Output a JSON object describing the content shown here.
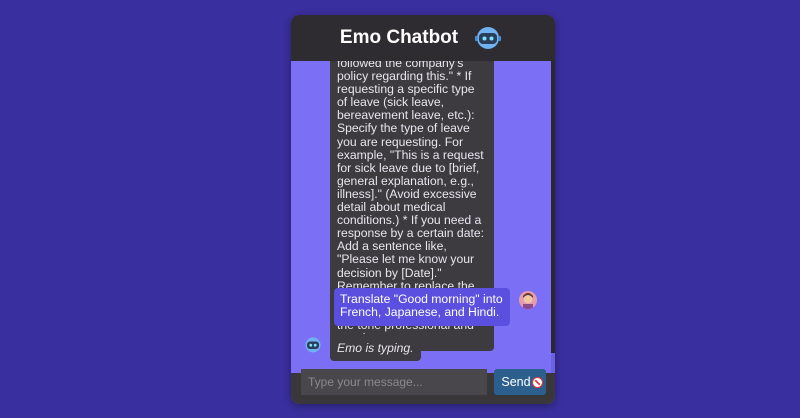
{
  "header": {
    "title": "Emo Chatbot",
    "icon": "robot-icon"
  },
  "messages": {
    "bot_response": "followed the company's policy regarding this.\" * If requesting a specific type of leave (sick leave, bereavement leave, etc.): Specify the type of leave you are requesting. For example, \"This is a request for sick leave due to [brief, general explanation, e.g., illness].\" (Avoid excessive detail about medical conditions.) * If you need a response by a certain date: Add a sentence like, \"Please let me know your decision by [Date].\" Remember to replace the bracketed information with your specific details. Keep the tone professional and concise.",
    "user_message": "Translate \"Good morning\" into French, Japanese, and Hindi.",
    "typing_text": "Emo is typing."
  },
  "input": {
    "placeholder": "Type your message...",
    "send_label": "Send"
  },
  "colors": {
    "page_background": "#3a2f9e",
    "chat_background": "#7b70f5",
    "header_background": "#2f2c31",
    "bot_bubble": "#3d3a40",
    "user_bubble": "#5a4fdf",
    "send_button": "#2c5f8e"
  }
}
